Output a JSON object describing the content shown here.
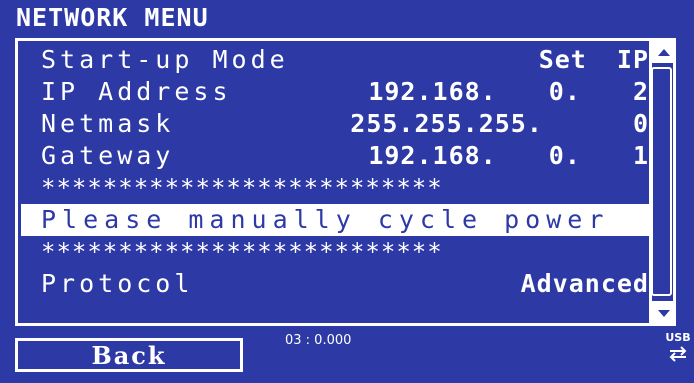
{
  "header": {
    "title": "NETWORK MENU"
  },
  "menu": {
    "rows": [
      {
        "label": "Start-up Mode",
        "value": "Set IP"
      },
      {
        "label": "IP Address",
        "value": "192.168. 0. 2"
      },
      {
        "label": "Netmask",
        "value": "255.255.255. 0"
      },
      {
        "label": "Gateway",
        "value": "192.168. 0. 1"
      },
      {
        "label": "**************************",
        "value": ""
      },
      {
        "label": "Please manually cycle power",
        "value": ""
      },
      {
        "label": "**************************",
        "value": ""
      },
      {
        "label": "Protocol",
        "value": "Advanced"
      }
    ]
  },
  "footer": {
    "back_label": "Back",
    "timer": "03 : 0.000",
    "usb_label": "USB"
  },
  "colors": {
    "background": "#2d3aa6",
    "foreground": "#ffffff"
  }
}
